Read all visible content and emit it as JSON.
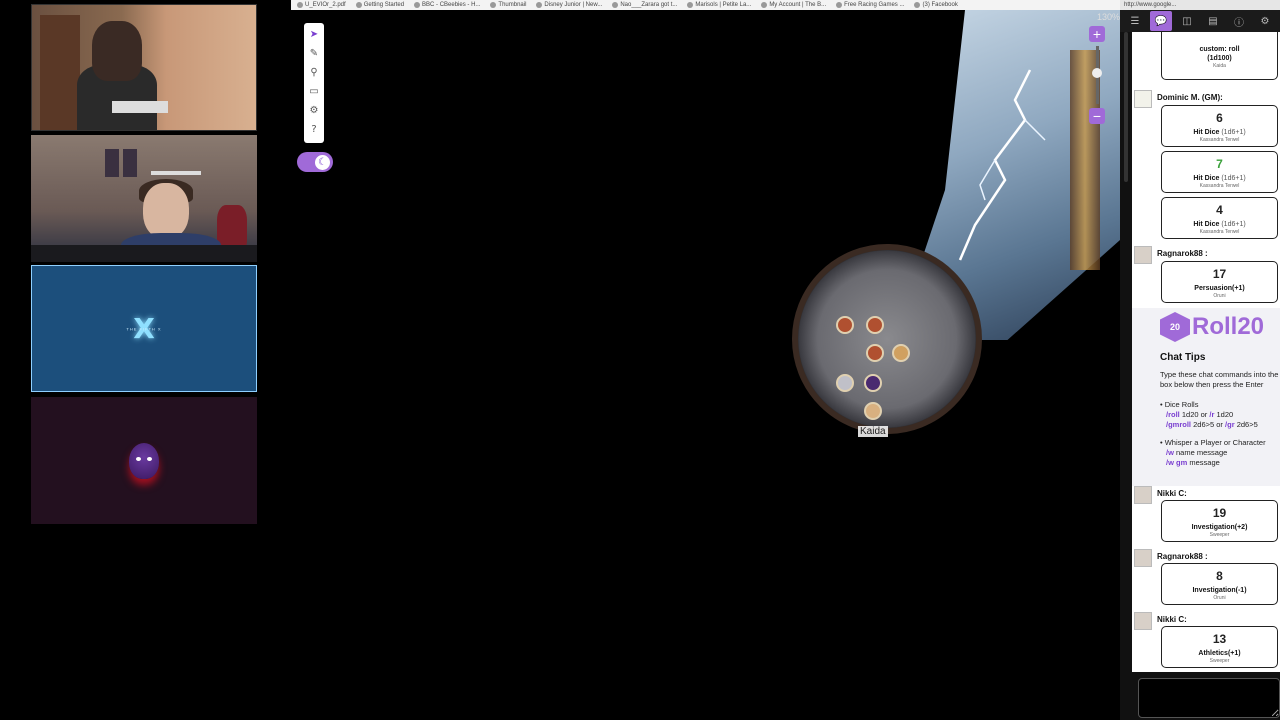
{
  "browser": {
    "bookmarks": [
      "U_EVIOr_2.pdf",
      "Getting Started",
      "BBC - CBeebies - H...",
      "Thumbnail",
      "Disney Junior | New...",
      "Nao___Zarara got t...",
      "Marisols | Petite La...",
      "My Account | The B...",
      "Free Racing Games ...",
      "(3) Facebook"
    ],
    "address_fragment": "http://www.google..."
  },
  "video_tiles": {
    "logo_mark": "X",
    "logo_text": "THE FIFTH X"
  },
  "map": {
    "zoom": "130%",
    "zoom_in": "+",
    "zoom_out": "−",
    "token_label": "Kaida"
  },
  "toolbar": {
    "select_icon": "cursor-arrow-icon",
    "draw_icon": "pencil-icon",
    "zoom_icon": "magnifier-icon",
    "ruler_icon": "ruler-icon",
    "settings_icon": "gear-icon",
    "help_icon": "help-icon",
    "toggle_icon": "moon-icon"
  },
  "chat": {
    "messages": [
      {
        "who": "",
        "value": "",
        "label": "custom: roll",
        "sub_label": "(1d100)",
        "char": "Kaida"
      },
      {
        "who": "Dominic M. (GM):",
        "value": "6",
        "label": "Hit Dice",
        "formula": "(1d6+1)",
        "char": "Kassandra Terwel"
      },
      {
        "who": "",
        "value": "7",
        "label": "Hit Dice",
        "formula": "(1d6+1)",
        "char": "Kassandra Terwel"
      },
      {
        "who": "",
        "value": "4",
        "label": "Hit Dice",
        "formula": "(1d6+1)",
        "char": "Kassandra Terwel"
      },
      {
        "who": "Ragnarok88 :",
        "value": "17",
        "label": "Persuasion(+1)",
        "char": "Oruni"
      },
      {
        "who": "Nikki C:",
        "value": "19",
        "label": "Investigation(+2)",
        "char": "Sweeper"
      },
      {
        "who": "Ragnarok88 :",
        "value": "8",
        "label": "Investigation(-1)",
        "char": "Oruni"
      },
      {
        "who": "Nikki C:",
        "value": "13",
        "label": "Athletics(+1)",
        "char": "Sweeper"
      }
    ],
    "tips": {
      "logo": "Roll20",
      "logo_die": "20",
      "title": "Chat Tips",
      "body": "Type these chat commands into the box below then press the Enter",
      "dice_header": "Dice Rolls",
      "roll_cmd": "/roll",
      "roll_text": "1d20 or",
      "roll_cmd2": "/r",
      "roll_text2": "1d20",
      "gm_cmd": "/gmroll",
      "gm_text": "2d6>5 or",
      "gm_cmd2": "/gr",
      "gm_text2": "2d6>5",
      "whisper_header": "Whisper a Player or Character",
      "w_cmd": "/w",
      "w_text": "name message",
      "wgm_cmd": "/w gm",
      "wgm_text": "message"
    }
  },
  "colors": {
    "accent": "#a06ad8",
    "green_roll": "#3aa03a"
  }
}
